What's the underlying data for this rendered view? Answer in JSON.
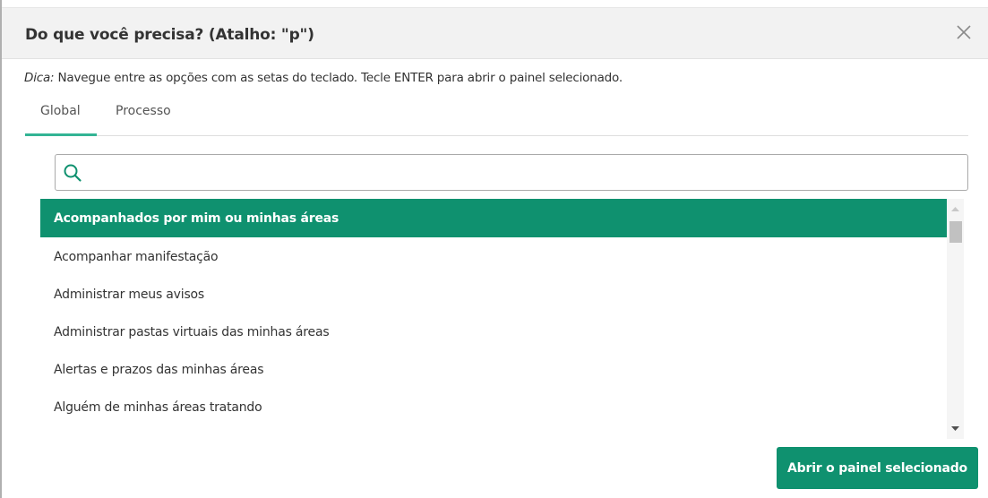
{
  "header": {
    "title": "Do que você precisa? (Atalho: \"p\")"
  },
  "tip": {
    "label": "Dica:",
    "text": " Navegue entre as opções com as setas do teclado. Tecle ENTER para abrir o painel selecionado."
  },
  "tabs": [
    {
      "label": "Global",
      "active": true
    },
    {
      "label": "Processo",
      "active": false
    }
  ],
  "search": {
    "value": "",
    "placeholder": ""
  },
  "list": {
    "items": [
      {
        "label": "Acompanhados por mim ou minhas áreas",
        "selected": true
      },
      {
        "label": "Acompanhar manifestação",
        "selected": false
      },
      {
        "label": "Administrar meus avisos",
        "selected": false
      },
      {
        "label": "Administrar pastas virtuais das minhas áreas",
        "selected": false
      },
      {
        "label": "Alertas e prazos das minhas áreas",
        "selected": false
      },
      {
        "label": "Alguém de minhas áreas tratando",
        "selected": false
      }
    ]
  },
  "footer": {
    "open_button_label": "Abrir o painel selecionado"
  },
  "colors": {
    "accent": "#0f916f",
    "tab_underline": "#33b494"
  },
  "icons": {
    "close": "close-icon",
    "search": "search-icon",
    "scroll_up": "triangle-up-icon",
    "scroll_down": "triangle-down-icon"
  }
}
